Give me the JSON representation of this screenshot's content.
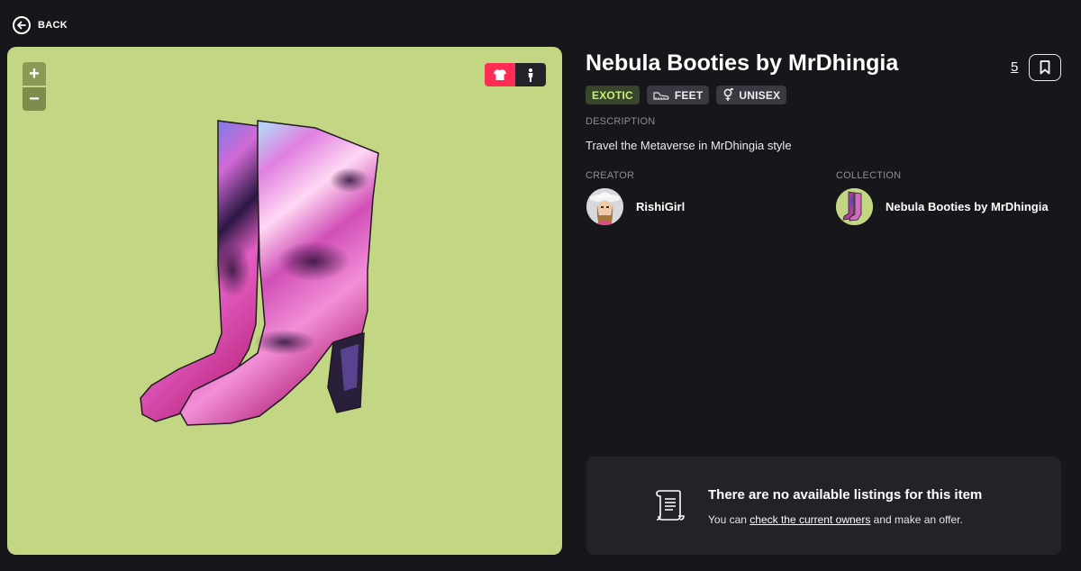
{
  "nav": {
    "back_label": "BACK"
  },
  "preview": {
    "background": "#c2d683",
    "zoom_in": "+",
    "zoom_out": "−",
    "view_toggle": [
      "wearable-icon",
      "avatar-icon"
    ]
  },
  "item": {
    "title": "Nebula Booties by MrDhingia",
    "favorites": "5",
    "tags": [
      {
        "label": "EXOTIC",
        "icon": ""
      },
      {
        "label": "FEET",
        "icon": "shoe-icon"
      },
      {
        "label": "UNISEX",
        "icon": "gender-icon"
      }
    ],
    "rarity_color": "#c8ef7b"
  },
  "description": {
    "label": "DESCRIPTION",
    "text": "Travel the Metaverse in MrDhingia style"
  },
  "creator": {
    "label": "CREATOR",
    "name": "RishiGirl"
  },
  "collection": {
    "label": "COLLECTION",
    "name": "Nebula Booties by MrDhingia"
  },
  "listing": {
    "title": "There are no available listings for this item",
    "sub_before": "You can ",
    "sub_link": "check the current owners",
    "sub_after": " and make an offer."
  },
  "colors": {
    "page_bg": "#17161a",
    "card_bg": "#242129",
    "accent": "#ff2d55"
  }
}
